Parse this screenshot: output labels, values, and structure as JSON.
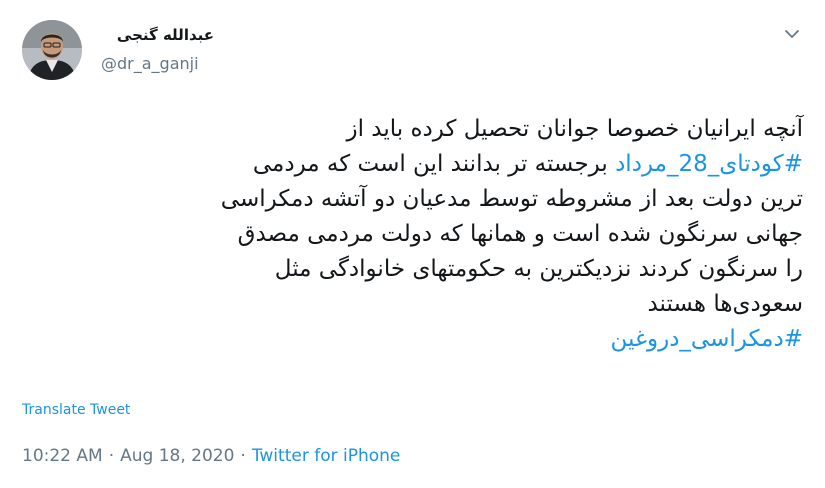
{
  "author": {
    "display_name": "عبدالله گنجی",
    "handle": "@dr_a_ganji"
  },
  "tweet": {
    "lines": [
      [
        {
          "text": "آنچه ایرانیان خصوصا جوانان تحصیل کرده باید از",
          "hashtag": false
        }
      ],
      [
        {
          "text": "#کودتای_28_مرداد",
          "hashtag": true
        },
        {
          "text": " برجسته تر بدانند این است که مردمی",
          "hashtag": false
        }
      ],
      [
        {
          "text": "ترین دولت بعد از مشروطه توسط مدعیان دو آتشه  دمکراسی",
          "hashtag": false
        }
      ],
      [
        {
          "text": "جهانی سرنگون شده است و همانها که دولت مردمی مصدق",
          "hashtag": false
        }
      ],
      [
        {
          "text": "را سرنگون کردند نزدیکترین به حکومتهای خانوادگی مثل",
          "hashtag": false
        }
      ],
      [
        {
          "text": "سعودی‌ها هستند",
          "hashtag": false
        }
      ],
      [
        {
          "text": "#دمکراسی_دروغین",
          "hashtag": true
        }
      ]
    ]
  },
  "translate_label": "Translate Tweet",
  "meta": {
    "time": "10:22 AM",
    "separator": "·",
    "date": "Aug 18, 2020",
    "source": "Twitter for iPhone"
  },
  "colors": {
    "link": "#1b95e0",
    "secondary_text": "#657786",
    "primary_text": "#14171a"
  },
  "icons": {
    "menu": "chevron-down-icon"
  }
}
